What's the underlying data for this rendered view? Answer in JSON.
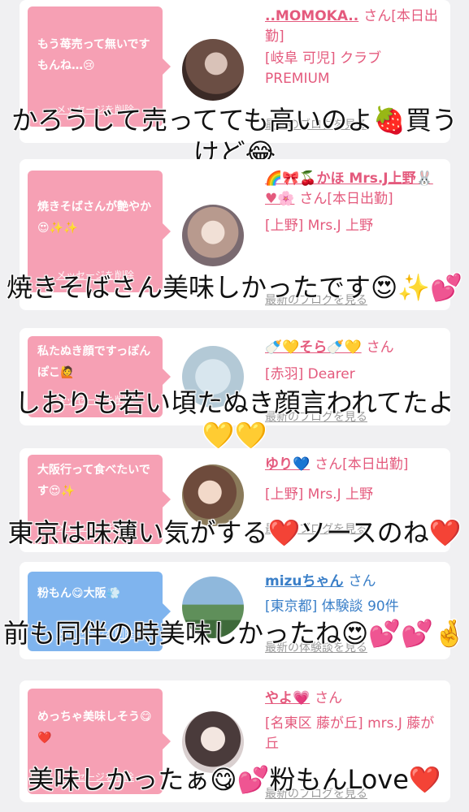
{
  "entries": [
    {
      "message": "もう苺売って無いですもんね…😢",
      "delete_label": "メッセージを削除",
      "name": "..MOMOKA..",
      "san": "さん[本日出勤]",
      "area": "[岐阜 可児] クラブPREMIUM",
      "link": "最新のブログを見る",
      "bubble_color": "#f6a0b4",
      "caption": "かろうじて売ってても高いのよ🍓買うけど😂"
    },
    {
      "message": "焼きそばさんが艶やか😍✨✨",
      "delete_label": "メッセージを削除",
      "name": "🌈🎀🍒かほ Mrs.J上野🐰♥🌸",
      "san": "さん[本日出勤]",
      "area": "[上野] Mrs.J 上野",
      "link": "最新のブログを見る",
      "bubble_color": "#f6a0b4",
      "caption": "焼きそばさん美味しかったです😍✨💕"
    },
    {
      "message": "私たぬき顔ですっぽんぽこ🙋",
      "delete_label": "メッセージを削除",
      "name": "🍼💛そら🍼💛",
      "san": "さん",
      "area": "[赤羽] Dearer",
      "link": "最新のブログを見る",
      "bubble_color": "#f6a0b4",
      "caption": "しおりも若い頃たぬき顔言われてたよ💛💛"
    },
    {
      "message": "大阪行って食べたいです😍✨",
      "delete_label": "メッセージを削除",
      "name": "ゆり💙",
      "san": "さん[本日出勤]",
      "area": "[上野] Mrs.J 上野",
      "link": "最新のブログを見る",
      "bubble_color": "#f6a0b4",
      "caption": "東京は味薄い気がする❤️ソースのね❤️"
    },
    {
      "message": "粉もん😋大阪💨",
      "delete_label": "メッセージを削除",
      "name": "mizuちゃん",
      "san": "さん",
      "area": "[東京都] 体験談 90件",
      "link": "最新の体験談を見る",
      "bubble_color": "#7fb4ee",
      "caption": "前も同伴の時美味しかったね😍💕💕🤞"
    },
    {
      "message": "めっちゃ美味しそう😋❤️",
      "delete_label": "メッセージを削除",
      "name": "やよ💗",
      "san": "さん",
      "area": "[名東区 藤が丘] mrs.J 藤が丘",
      "link": "最新のブログを見る",
      "bubble_color": "#f6a0b4",
      "caption": "美味しかったぁ😋💕粉もんLove❤️"
    }
  ]
}
